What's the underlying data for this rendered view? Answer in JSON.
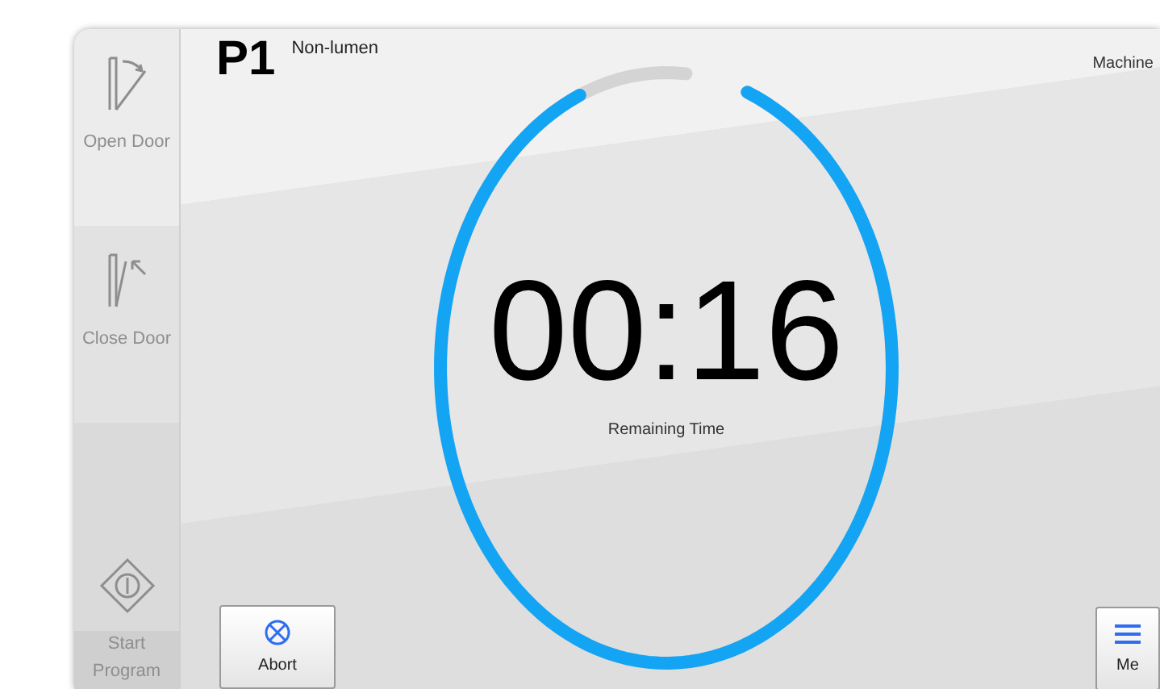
{
  "sidebar": {
    "items": [
      {
        "kind": "open-door",
        "label": "Open Door",
        "disabled": true
      },
      {
        "kind": "close-door",
        "label": "Close Door",
        "disabled": true
      },
      {
        "kind": "start",
        "label": "Start Program",
        "disabled": true
      }
    ]
  },
  "header": {
    "program": "P1",
    "name": "Non-lumen",
    "machine": "Machine"
  },
  "timer": {
    "value": "00:16",
    "label": "Remaining Time",
    "level": 0.92
  },
  "buttons": [
    {
      "kind": "abort",
      "label": "Abort"
    },
    {
      "kind": "menu",
      "label": "Me"
    }
  ]
}
